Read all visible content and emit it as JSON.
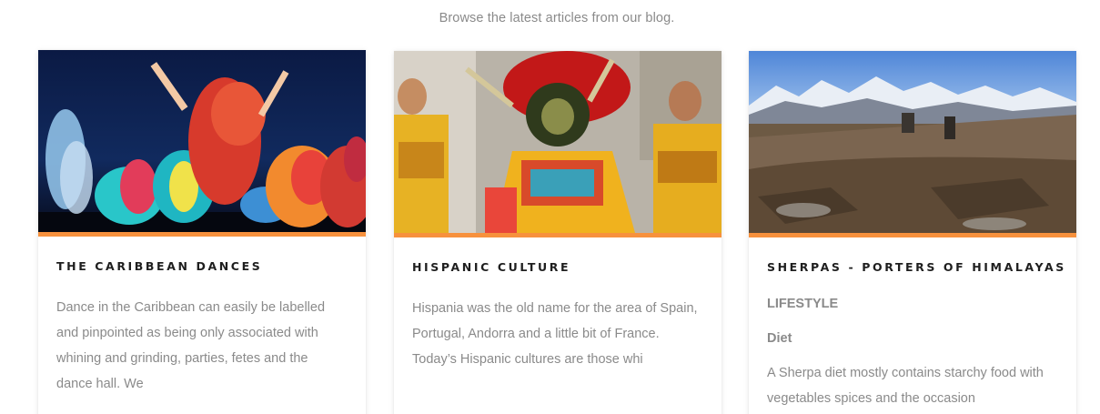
{
  "intro": {
    "text": "Browse the latest articles from our blog."
  },
  "colors": {
    "accent": "#f7913d",
    "title": "#1f1f1f",
    "body_text": "#8a8a8a"
  },
  "posts": [
    {
      "title": "THE CARIBBEAN DANCES",
      "excerpt": "Dance in the Caribbean can easily be labelled and pinpointed as being only associated with whining and grinding, parties, fetes and the dance hall. We"
    },
    {
      "title": "HISPANIC CULTURE",
      "excerpt": "Hispania was the old name for the area of Spain, Portugal, Andorra and a little bit of France. Today’s Hispanic cultures are those whi"
    },
    {
      "title": "SHERPAS - PORTERS OF HIMALAYAS",
      "heading_1": "LIFESTYLE",
      "heading_2": "Diet",
      "excerpt": "A Sherpa diet mostly contains starchy food with vegetables spices and the occasion"
    }
  ]
}
